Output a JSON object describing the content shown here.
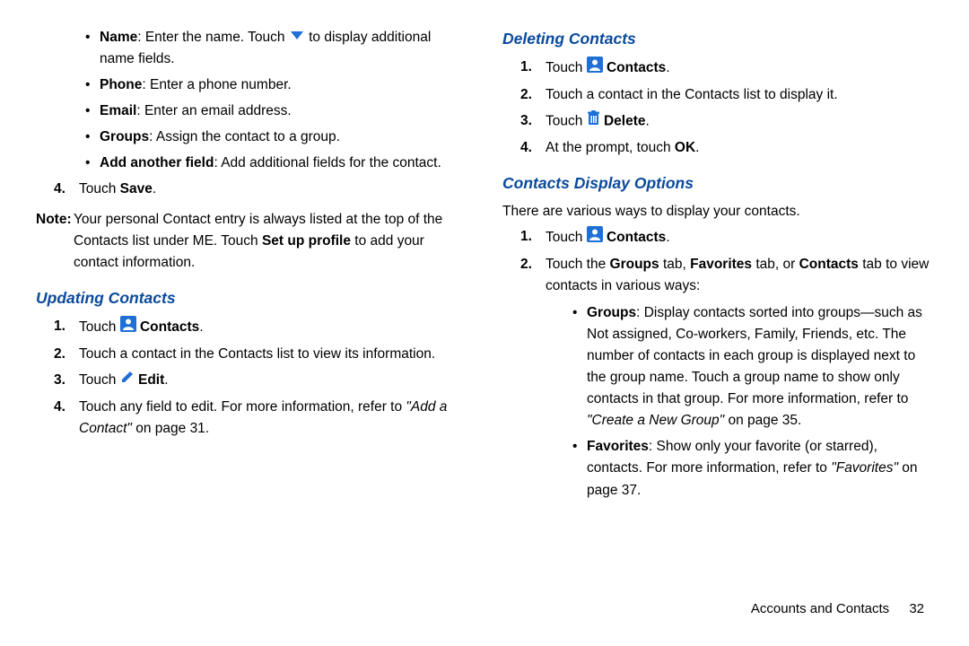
{
  "left": {
    "bullets": [
      {
        "label": "Name",
        "text": ": Enter the name. Touch ",
        "icon": "chevron-down",
        "after": " to display additional name fields."
      },
      {
        "label": "Phone",
        "text": ": Enter a phone number."
      },
      {
        "label": "Email",
        "text": ": Enter an email address."
      },
      {
        "label": "Groups",
        "text": ": Assign the contact to a group."
      },
      {
        "label": "Add another field",
        "text": ": Add additional fields for the contact."
      }
    ],
    "step4_prefix": "Touch ",
    "step4_bold": "Save",
    "step4_suffix": ".",
    "note_label": "Note:",
    "note_text_a": " Your personal Contact entry is always listed at the top of the Contacts list under ME. Touch ",
    "note_bold": "Set up profile",
    "note_text_b": " to add your contact information.",
    "updating_heading": "Updating Contacts",
    "updating": {
      "s1_pre": "Touch ",
      "s1_bold": "Contacts",
      "s1_post": ".",
      "s2": "Touch a contact in the Contacts list to view its information.",
      "s3_pre": "Touch ",
      "s3_bold": "Edit",
      "s3_post": ".",
      "s4_pre": "Touch any field to edit. For more information, refer to ",
      "s4_ital": "\"Add a Contact\"",
      "s4_post": " on page 31."
    }
  },
  "right": {
    "deleting_heading": "Deleting Contacts",
    "deleting": {
      "s1_pre": "Touch ",
      "s1_bold": "Contacts",
      "s1_post": ".",
      "s2": "Touch a contact in the Contacts list to display it.",
      "s3_pre": "Touch ",
      "s3_bold": "Delete",
      "s3_post": ".",
      "s4_pre": "At the prompt, touch ",
      "s4_bold": "OK",
      "s4_post": "."
    },
    "display_heading": "Contacts Display Options",
    "display_intro": "There are various ways to display your contacts.",
    "display": {
      "s1_pre": "Touch ",
      "s1_bold": "Contacts",
      "s1_post": ".",
      "s2_pre": "Touch the ",
      "s2_b1": "Groups",
      "s2_mid1": " tab, ",
      "s2_b2": "Favorites",
      "s2_mid2": " tab, or ",
      "s2_b3": "Contacts",
      "s2_post": " tab to view contacts in various ways:",
      "sub_groups_label": "Groups",
      "sub_groups_text_a": ": Display contacts sorted into groups—such as Not assigned, Co-workers, Family, Friends, etc. The number of contacts in each group is displayed next to the group name. Touch a group name to show only contacts in that group. For more information, refer to ",
      "sub_groups_ital": "\"Create a New Group\"",
      "sub_groups_text_b": " on page 35.",
      "sub_fav_label": "Favorites",
      "sub_fav_text_a": ": Show only your favorite (or starred), contacts. For more information, refer to ",
      "sub_fav_ital": "\"Favorites\"",
      "sub_fav_text_b": " on page 37."
    }
  },
  "footer_section": "Accounts and Contacts",
  "footer_page": "32"
}
